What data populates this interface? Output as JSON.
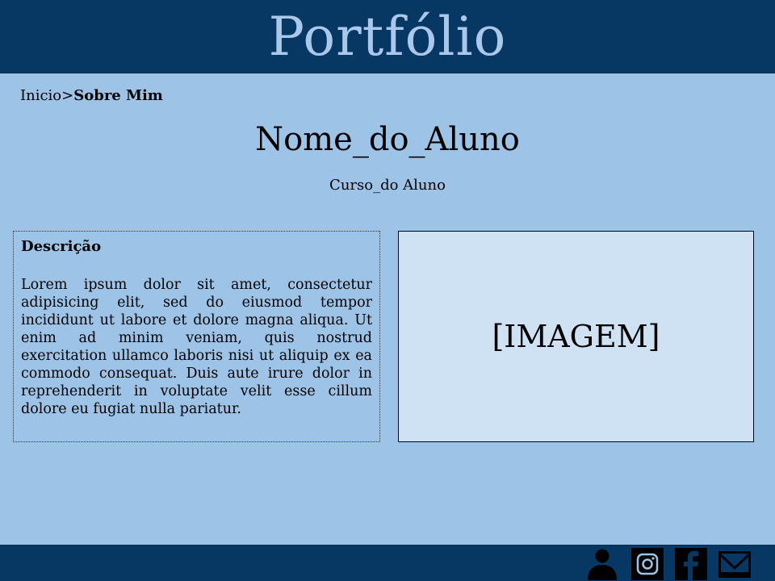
{
  "header": {
    "title": "Portfólio"
  },
  "breadcrumb": {
    "home": "Inicio",
    "separator": ">",
    "current": "Sobre Mim"
  },
  "profile": {
    "name": "Nome_do_Aluno",
    "course": "Curso_do Aluno"
  },
  "description": {
    "title": "Descrição",
    "text": "Lorem ipsum dolor sit amet, consectetur adipisicing elit, sed do eiusmod tempor incididunt ut labore et dolore magna aliqua. Ut enim ad minim veniam, quis nostrud exercitation ullamco laboris nisi ut aliquip ex ea commodo consequat. Duis aute irure dolor in reprehenderit in voluptate velit esse cillum dolore eu fugiat nulla pariatur."
  },
  "image_placeholder": {
    "label": "[IMAGEM]"
  },
  "footer": {
    "icons": [
      "user-icon",
      "instagram-icon",
      "facebook-icon",
      "mail-icon"
    ]
  },
  "colors": {
    "header_bg": "#073763",
    "page_bg": "#9dc3e6",
    "title_text": "#a9c8ea",
    "image_bg": "#cfe2f3"
  }
}
